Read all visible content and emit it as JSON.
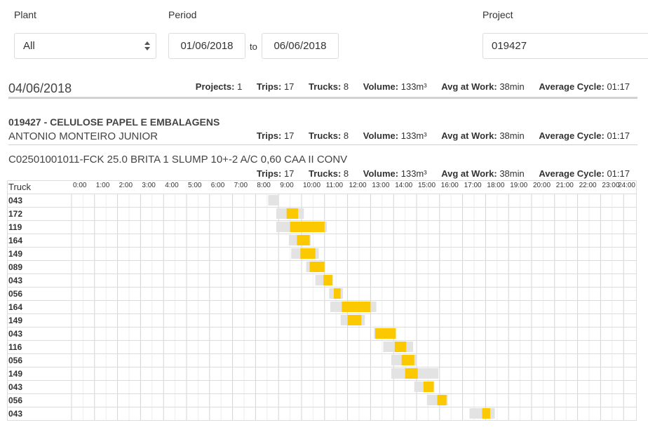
{
  "filters": {
    "plant_label": "Plant",
    "plant_value": "All",
    "period_label": "Period",
    "period_from": "01/06/2018",
    "period_to_word": "to",
    "period_to": "06/06/2018",
    "project_label": "Project",
    "project_value": "019427"
  },
  "day": {
    "date": "04/06/2018",
    "stats": {
      "projects_label": "Projects:",
      "projects": "1",
      "trips_label": "Trips:",
      "trips": "17",
      "trucks_label": "Trucks:",
      "trucks": "8",
      "volume_label": "Volume:",
      "volume": "133m³",
      "avg_label": "Avg at Work:",
      "avg": "38min",
      "cycle_label": "Average Cycle:",
      "cycle": "01:17"
    }
  },
  "project": {
    "title": "019427 -  CELULOSE PAPEL E EMBALAGENS",
    "client": "ANTONIO MONTEIRO JUNIOR",
    "stats": {
      "trips_label": "Trips:",
      "trips": "17",
      "trucks_label": "Trucks:",
      "trucks": "8",
      "volume_label": "Volume:",
      "volume": "133m³",
      "avg_label": "Avg at Work:",
      "avg": "38min",
      "cycle_label": "Average Cycle:",
      "cycle": "01:17"
    }
  },
  "product": {
    "name": "C02501001011-FCK 25.0 BRITA 1 SLUMP 10+-2 A/C 0,60 CAA II CONV",
    "stats": {
      "trips_label": "Trips:",
      "trips": "17",
      "trucks_label": "Trucks:",
      "trucks": "8",
      "volume_label": "Volume:",
      "volume": "133m³",
      "avg_label": "Avg at Work:",
      "avg": "38min",
      "cycle_label": "Average Cycle:",
      "cycle": "01:17"
    }
  },
  "chart_data": {
    "type": "gantt",
    "row_header": "Truck",
    "hours": [
      "0:00",
      "1:00",
      "2:00",
      "3:00",
      "4:00",
      "5:00",
      "6:00",
      "7:00",
      "8:00",
      "9:00",
      "10:00",
      "11:00",
      "12:00",
      "13:00",
      "14:00",
      "15:00",
      "16:00",
      "17:00",
      "18:00",
      "19:00",
      "20:00",
      "21:00",
      "22:00",
      "23:00",
      "24:00"
    ],
    "colors": {
      "trip": "#e3e3e3",
      "work": "#fcc900"
    },
    "rows": [
      {
        "truck": "043",
        "trip": [
          8.55,
          9.0
        ],
        "work": null
      },
      {
        "truck": "172",
        "trip": [
          8.9,
          10.1
        ],
        "work": [
          9.35,
          9.85
        ]
      },
      {
        "truck": "119",
        "trip": [
          8.9,
          11.1
        ],
        "work": [
          9.5,
          11.0
        ]
      },
      {
        "truck": "164",
        "trip": [
          9.45,
          10.4
        ],
        "work": [
          9.8,
          10.35
        ]
      },
      {
        "truck": "149",
        "trip": [
          9.55,
          10.75
        ],
        "work": [
          9.95,
          10.6
        ]
      },
      {
        "truck": "089",
        "trip": [
          10.2,
          11.0
        ],
        "work": [
          10.35,
          11.0
        ]
      },
      {
        "truck": "043",
        "trip": [
          10.6,
          11.3
        ],
        "work": [
          10.95,
          11.35
        ]
      },
      {
        "truck": "056",
        "trip": [
          11.2,
          11.8
        ],
        "work": [
          11.4,
          11.7
        ]
      },
      {
        "truck": "164",
        "trip": [
          11.25,
          13.25
        ],
        "work": [
          11.75,
          13.0
        ]
      },
      {
        "truck": "149",
        "trip": [
          11.7,
          12.75
        ],
        "work": [
          12.0,
          12.6
        ]
      },
      {
        "truck": "043",
        "trip": [
          13.15,
          14.1
        ],
        "work": [
          13.2,
          14.1
        ]
      },
      {
        "truck": "116",
        "trip": [
          13.55,
          14.85
        ],
        "work": [
          14.05,
          14.55
        ]
      },
      {
        "truck": "056",
        "trip": [
          13.9,
          15.0
        ],
        "work": [
          14.35,
          14.9
        ]
      },
      {
        "truck": "149",
        "trip": [
          13.9,
          15.95
        ],
        "work": [
          14.5,
          15.05
        ]
      },
      {
        "truck": "043",
        "trip": [
          14.9,
          15.75
        ],
        "work": [
          15.3,
          15.75
        ]
      },
      {
        "truck": "056",
        "trip": [
          15.45,
          16.35
        ],
        "work": [
          15.9,
          16.3
        ]
      },
      {
        "truck": "043",
        "trip": [
          17.3,
          18.4
        ],
        "work": [
          17.85,
          18.2
        ]
      }
    ]
  }
}
